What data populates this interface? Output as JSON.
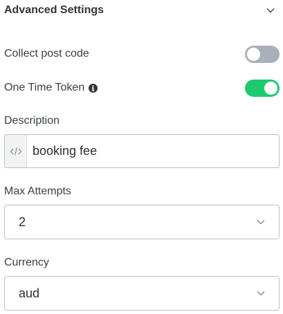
{
  "section": {
    "title": "Advanced Settings",
    "icon": "chevron-down-icon",
    "expanded": true
  },
  "collect_post_code": {
    "label": "Collect post code",
    "enabled": false
  },
  "one_time_token": {
    "label": "One Time Token",
    "info_icon": "info-circle-icon",
    "enabled": true,
    "accent_color": "#1fc96f"
  },
  "description": {
    "label": "Description",
    "addon_icon": "code-icon",
    "value": "booking fee"
  },
  "max_attempts": {
    "label": "Max Attempts",
    "value": "2"
  },
  "currency": {
    "label": "Currency",
    "value": "aud"
  },
  "colors": {
    "toggle_off": "#a9b0b9",
    "toggle_on": "#1fc96f",
    "border": "#b9bfc6"
  }
}
